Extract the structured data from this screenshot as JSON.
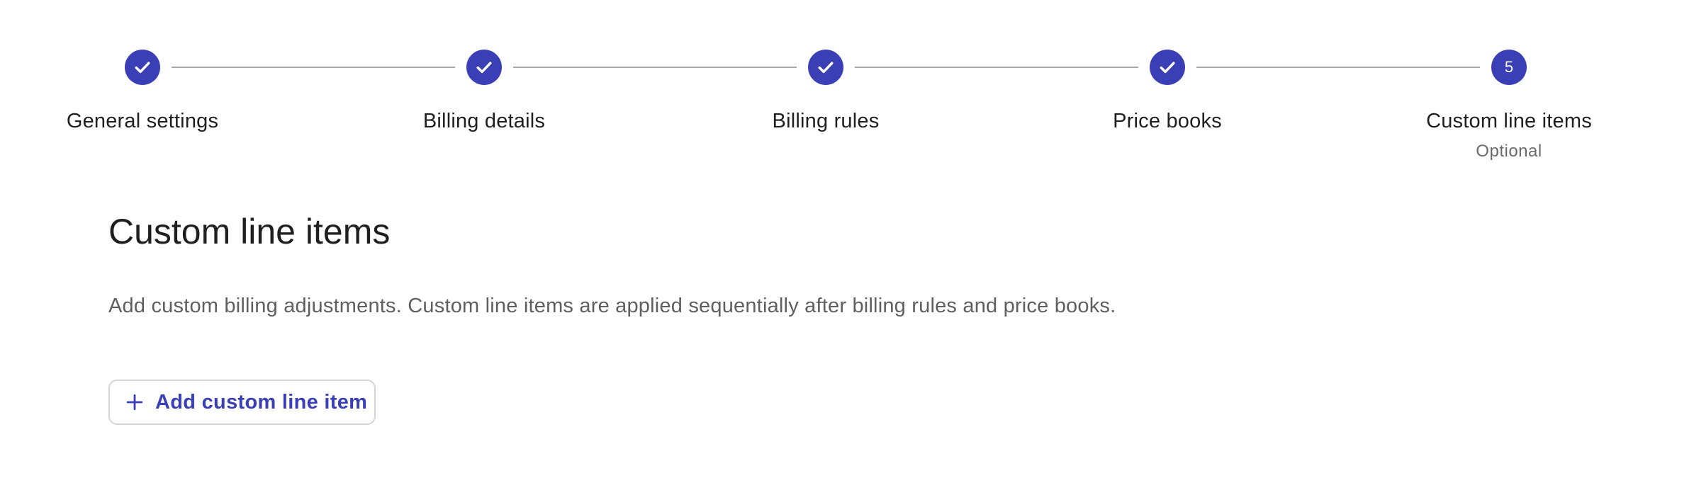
{
  "stepper": {
    "steps": [
      {
        "label": "General settings",
        "status": "completed",
        "icon": "check-icon"
      },
      {
        "label": "Billing details",
        "status": "completed",
        "icon": "check-icon"
      },
      {
        "label": "Billing rules",
        "status": "completed",
        "icon": "check-icon"
      },
      {
        "label": "Price books",
        "status": "completed",
        "icon": "check-icon"
      },
      {
        "label": "Custom line items",
        "status": "active",
        "number": "5",
        "sublabel": "Optional"
      }
    ]
  },
  "main": {
    "title": "Custom line items",
    "description": "Add custom billing adjustments. Custom line items are applied sequentially after billing rules and price books.",
    "add_button_label": "Add custom line item",
    "add_button_icon": "plus-icon"
  },
  "colors": {
    "accent": "#3b3fb5",
    "connector": "#a9a9ad",
    "text_primary": "#1f1f1f",
    "text_secondary": "#5f5f5f",
    "button_border": "#d4d4d8"
  }
}
